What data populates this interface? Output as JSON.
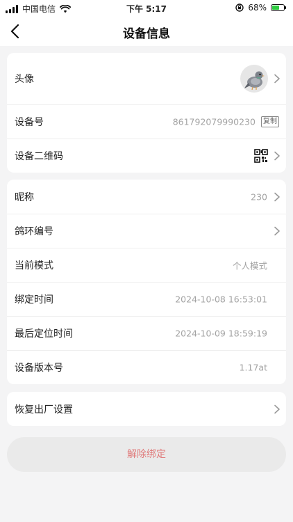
{
  "status_bar": {
    "carrier": "中国电信",
    "time": "下午 5:17",
    "battery_percent": "68%",
    "battery_level": 0.68,
    "icons": [
      "signal-icon",
      "wifi-icon",
      "orientation-lock-icon",
      "battery-icon"
    ]
  },
  "nav": {
    "title": "设备信息",
    "back_icon": "chevron-left-icon"
  },
  "section1": {
    "avatar_label": "头像",
    "device_no_label": "设备号",
    "device_no_value": "861792079990230",
    "copy_label": "复制",
    "qr_label": "设备二维码"
  },
  "section2": {
    "nickname_label": "昵称",
    "nickname_value": "230",
    "ring_label": "鸽环编号",
    "mode_label": "当前模式",
    "mode_value": "个人模式",
    "bind_time_label": "绑定时间",
    "bind_time_value": "2024-10-08 16:53:01",
    "last_loc_label": "最后定位时间",
    "last_loc_value": "2024-10-09 18:59:19",
    "version_label": "设备版本号",
    "version_value": "1.17at"
  },
  "section3": {
    "factory_reset_label": "恢复出厂设置"
  },
  "unbind_label": "解除绑定",
  "colors": {
    "background": "#f4f4f5",
    "card": "#ffffff",
    "value_text": "#a3a3a3",
    "danger_text": "#e07b7b",
    "button_bg": "#eaeaea",
    "battery": "#2ecc40"
  }
}
